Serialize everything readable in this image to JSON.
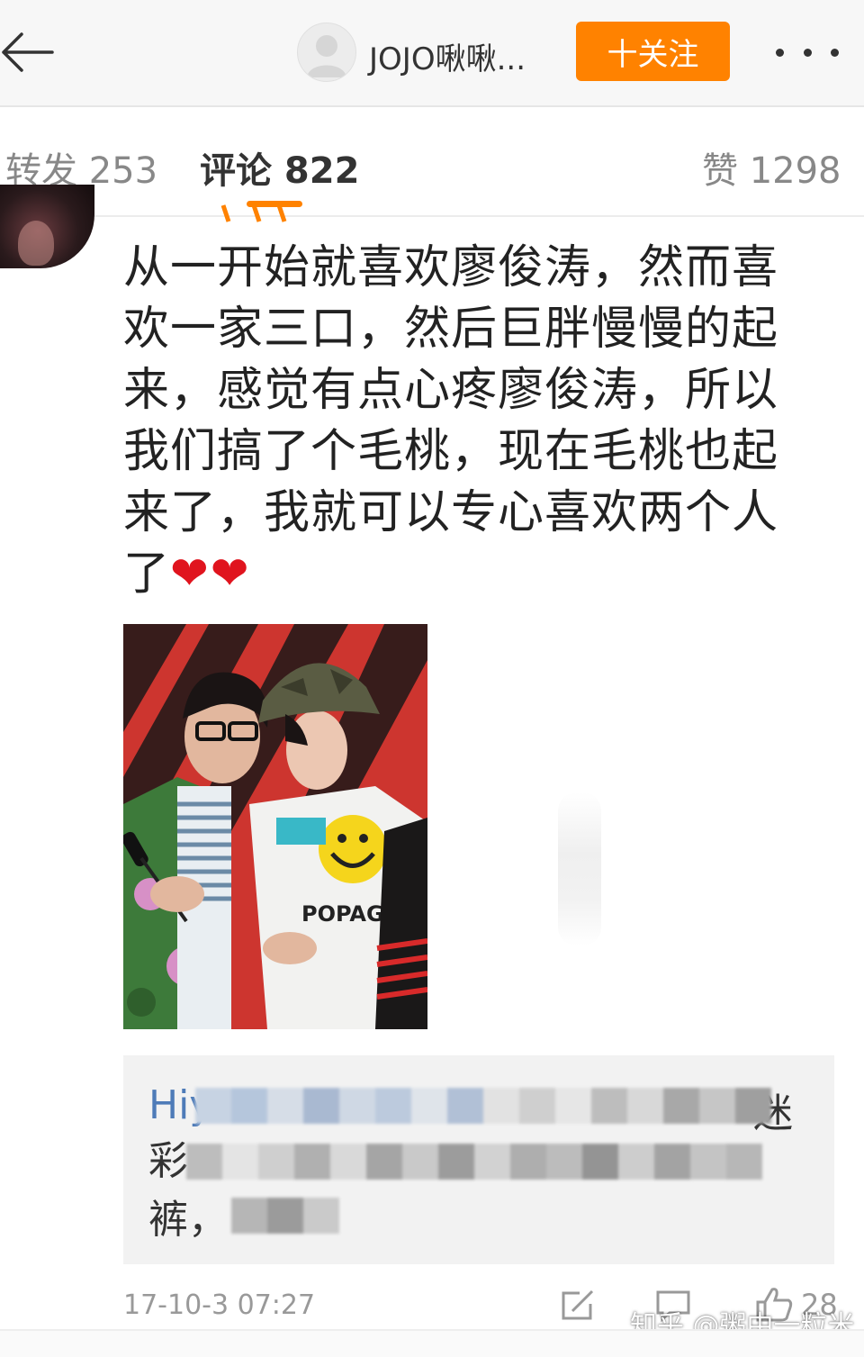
{
  "header": {
    "back_icon": "arrow-left-icon",
    "username": "JOJO啾啾...",
    "follow_label": "十关注",
    "more_icon": "more-dots-icon",
    "accent_color": "#ff8200"
  },
  "tabs": [
    {
      "label": "转发 253"
    },
    {
      "label": "评论 822"
    },
    {
      "label": "赞 1298"
    }
  ],
  "comment": {
    "text": "从一开始就喜欢廖俊涛，然而喜欢一家三口，然后巨胖慢慢的起来，感觉有点心疼廖俊涛，所以我们搞了个毛桃，现在毛桃也起来了，我就可以专心喜欢两个人了",
    "hearts": "❤❤",
    "quote": {
      "user_prefix": "Hiy",
      "line1_end": "迷",
      "line2_start": "彩",
      "line3_start": "裤，"
    },
    "time": "17-10-3 07:27",
    "share_icon": "share-icon",
    "comment_icon": "comment-icon",
    "like_icon": "thumbs-up-icon",
    "likes": "28"
  },
  "watermark": "知乎 @粥中一粒米"
}
